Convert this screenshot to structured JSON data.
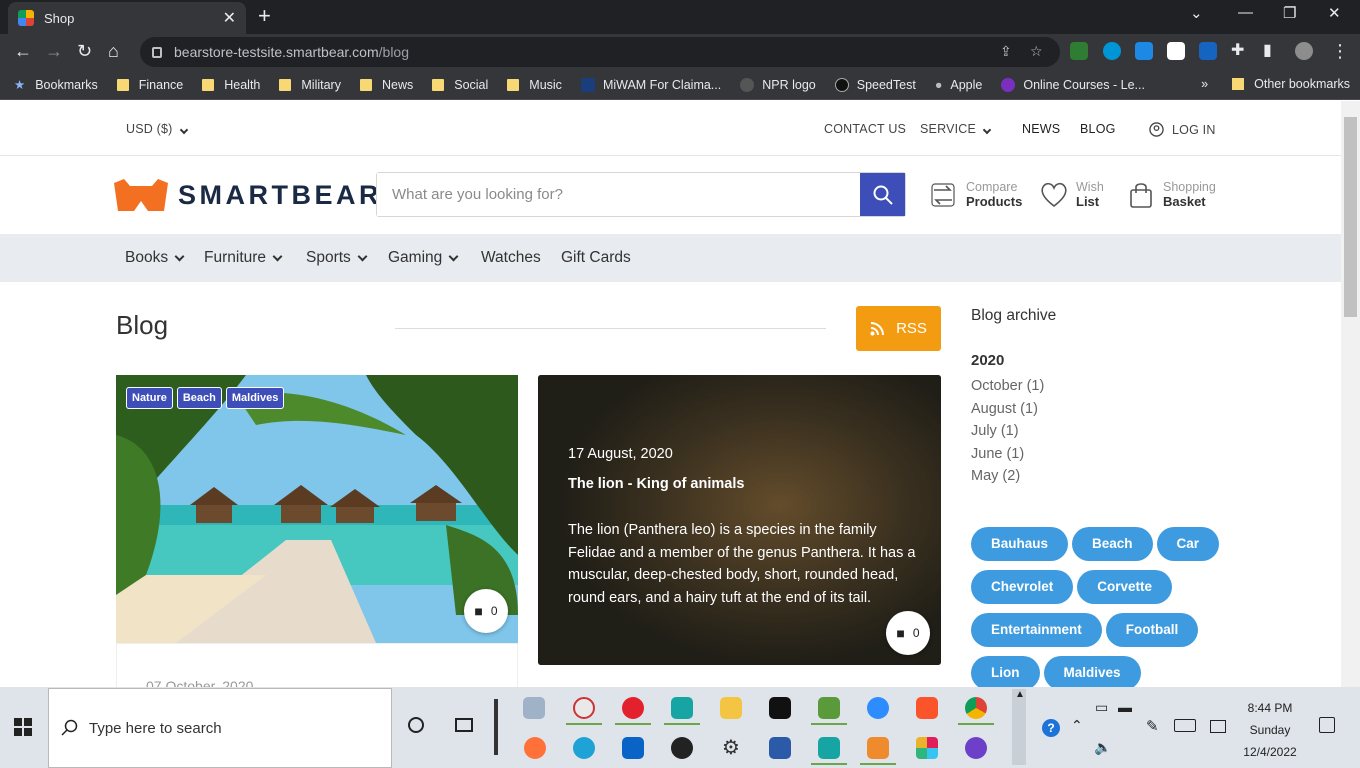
{
  "browser": {
    "tab_title": "Shop",
    "url_host": "bearstore-testsite.smartbear.com",
    "url_path": "/blog",
    "bookmarks": [
      {
        "label": "Bookmarks",
        "type": "star"
      },
      {
        "label": "Finance",
        "type": "folder"
      },
      {
        "label": "Health",
        "type": "folder"
      },
      {
        "label": "Military",
        "type": "folder"
      },
      {
        "label": "News",
        "type": "folder"
      },
      {
        "label": "Social",
        "type": "folder"
      },
      {
        "label": "Music",
        "type": "folder"
      },
      {
        "label": "MiWAM For Claima...",
        "type": "site"
      },
      {
        "label": "NPR logo",
        "type": "site"
      },
      {
        "label": "SpeedTest",
        "type": "site"
      },
      {
        "label": "Apple",
        "type": "site"
      },
      {
        "label": "Online Courses - Le...",
        "type": "site"
      }
    ],
    "more_bookmarks": "»",
    "other_bookmarks": "Other bookmarks"
  },
  "topbar": {
    "currency": "USD  ($)",
    "contact": "CONTACT US",
    "service": "SERVICE",
    "news": "NEWS",
    "blog": "BLOG",
    "login": "LOG IN"
  },
  "header": {
    "brand": "SMARTBEAR",
    "search_placeholder": "What are you looking for?",
    "compare_small": "Compare",
    "compare_big": "Products",
    "wish_small": "Wish",
    "wish_big": "List",
    "basket_small": "Shopping",
    "basket_big": "Basket"
  },
  "categories": [
    "Books",
    "Furniture",
    "Sports",
    "Gaming",
    "Watches",
    "Gift Cards"
  ],
  "blog": {
    "title": "Blog",
    "rss": "RSS",
    "posts": [
      {
        "tags": [
          "Nature",
          "Beach",
          "Maldives"
        ],
        "comments": "0",
        "date": "07 October, 2020"
      },
      {
        "date": "17 August, 2020",
        "title": "The lion - King of animals",
        "excerpt": "The lion (Panthera leo) is a species in the family Felidae and a member of the genus Panthera. It has a muscular, deep-chested body, short, rounded head, round ears, and a hairy tuft at the end of its tail.",
        "comments": "0"
      }
    ]
  },
  "sidebar": {
    "archive_title": "Blog archive",
    "year": "2020",
    "months": [
      "October (1)",
      "August (1)",
      "July (1)",
      "June (1)",
      "May (2)"
    ],
    "tags": [
      "Bauhaus",
      "Beach",
      "Car",
      "Chevrolet",
      "Corvette",
      "Entertainment",
      "Football",
      "Lion",
      "Maldives"
    ]
  },
  "taskbar": {
    "search_placeholder": "Type here to search",
    "time": "8:44 PM",
    "day": "Sunday",
    "date": "12/4/2022"
  },
  "colors": {
    "accent": "#3d4eb8",
    "rss": "#f39c12",
    "tag_pill": "#3e9be0",
    "brand_orange": "#f36f21"
  }
}
